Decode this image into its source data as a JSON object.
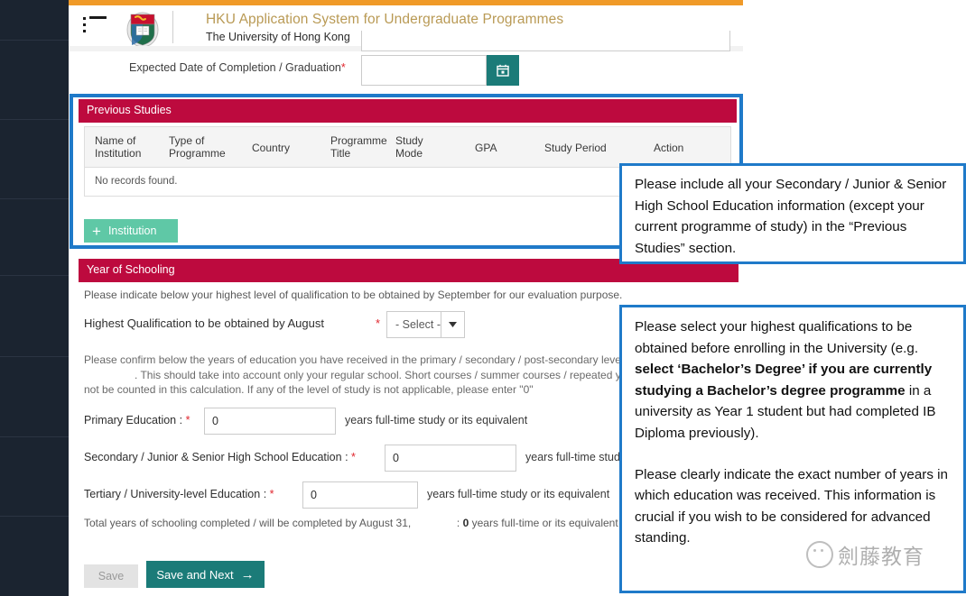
{
  "header": {
    "title": "HKU Application System for Undergraduate Programmes",
    "subtitle": "The University of Hong Kong",
    "menu_icon": "hamburger-menu-icon",
    "logo_alt": "hku-crest-logo"
  },
  "form": {
    "expected_date_label": "Expected Date of Completion / Graduation",
    "expected_date_required": "*",
    "expected_date_value": "",
    "calendar_icon": "calendar-icon"
  },
  "previous_studies": {
    "section_title": "Previous Studies",
    "columns": [
      "Name of Institution",
      "Type of Programme",
      "Country",
      "Programme Title",
      "Study Mode",
      "GPA",
      "Study Period",
      "Action"
    ],
    "empty_message": "No records found.",
    "add_button_label": "Institution",
    "add_button_icon": "plus-icon"
  },
  "year_of_schooling": {
    "section_title": "Year of Schooling",
    "intro": "Please indicate below your highest level of qualification to be obtained by September for our evaluation purpose.",
    "highest_qualification_label": "Highest Qualification to be obtained by August",
    "highest_qualification_required": "*",
    "highest_qualification_value": "- Select -",
    "dropdown_icon": "chevron-down-icon",
    "paragraph_line1": "Please confirm below the years of education you have received in the primary / secondary / post-secondary levels",
    "paragraph_line2": ". This should take into account only your regular school. Short courses / summer courses / repeated years should",
    "paragraph_line3": "not be counted in this calculation. If any of the level of study is not applicable, please enter \"0\"",
    "rows": [
      {
        "label": "Primary Education",
        "colon": ":",
        "required": "*",
        "value": "0",
        "suffix": "years full-time study or its equivalent"
      },
      {
        "label": "Secondary / Junior & Senior High School Education",
        "colon": ":",
        "required": "*",
        "value": "0",
        "suffix": "years full-time study or its equivalent"
      },
      {
        "label": "Tertiary / University-level Education",
        "colon": ":",
        "required": "*",
        "value": "0",
        "suffix": "years full-time study or its equivalent"
      }
    ],
    "total_label": "Total years of schooling completed / will be completed by August 31,",
    "total_colon": ":",
    "total_value": "0",
    "total_suffix": "years full-time or its equivalent"
  },
  "footer": {
    "save_label": "Save",
    "save_next_label": "Save and Next",
    "arrow_icon": "arrow-right-icon"
  },
  "annotations": {
    "callout_1": "Please include all your Secondary / Junior & Senior High School Education information (except your current programme of study) in the “Previous Studies” section.",
    "callout_2_part1": "Please select your highest qualifications to be obtained before enrolling in the University (e.g. ",
    "callout_2_bold": "select ‘Bachelor’s Degree’ if you are currently studying a Bachelor’s degree programme",
    "callout_2_part2": " in a university as Year 1 student but had completed IB Diploma previously).",
    "callout_2_part3": "Please clearly indicate the exact number of years in which education was received. This information is crucial if you wish to be considered for advanced standing."
  },
  "watermark": {
    "text": "劍藤教育",
    "icon": "wechat-icon"
  },
  "colors": {
    "brand_red": "#bd0a3e",
    "accent_orange": "#f09a28",
    "teal": "#1b7b78",
    "mint": "#5fc8a6",
    "highlight_blue": "#1f7ac9",
    "rail_dark": "#1b2430",
    "gold_title": "#b99a55"
  }
}
